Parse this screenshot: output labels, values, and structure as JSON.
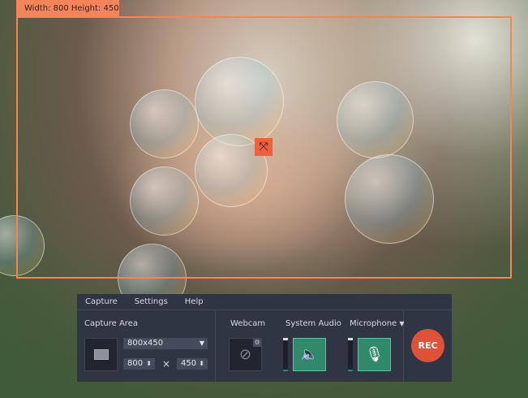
{
  "overlay": {
    "size_label": "Width: 800 Height: 450",
    "accent": "#f4845a"
  },
  "menu": {
    "items": [
      "Capture",
      "Settings",
      "Help"
    ]
  },
  "capture_area": {
    "label": "Capture Area",
    "preset": "800x450",
    "width": "800",
    "height": "450",
    "times": "×"
  },
  "webcam": {
    "label": "Webcam",
    "state": "off"
  },
  "system_audio": {
    "label": "System Audio",
    "level": 0.05
  },
  "microphone": {
    "label": "Microphone",
    "dropdown": "▼",
    "level": 0.05
  },
  "rec": {
    "label": "REC",
    "color": "#e05237"
  }
}
